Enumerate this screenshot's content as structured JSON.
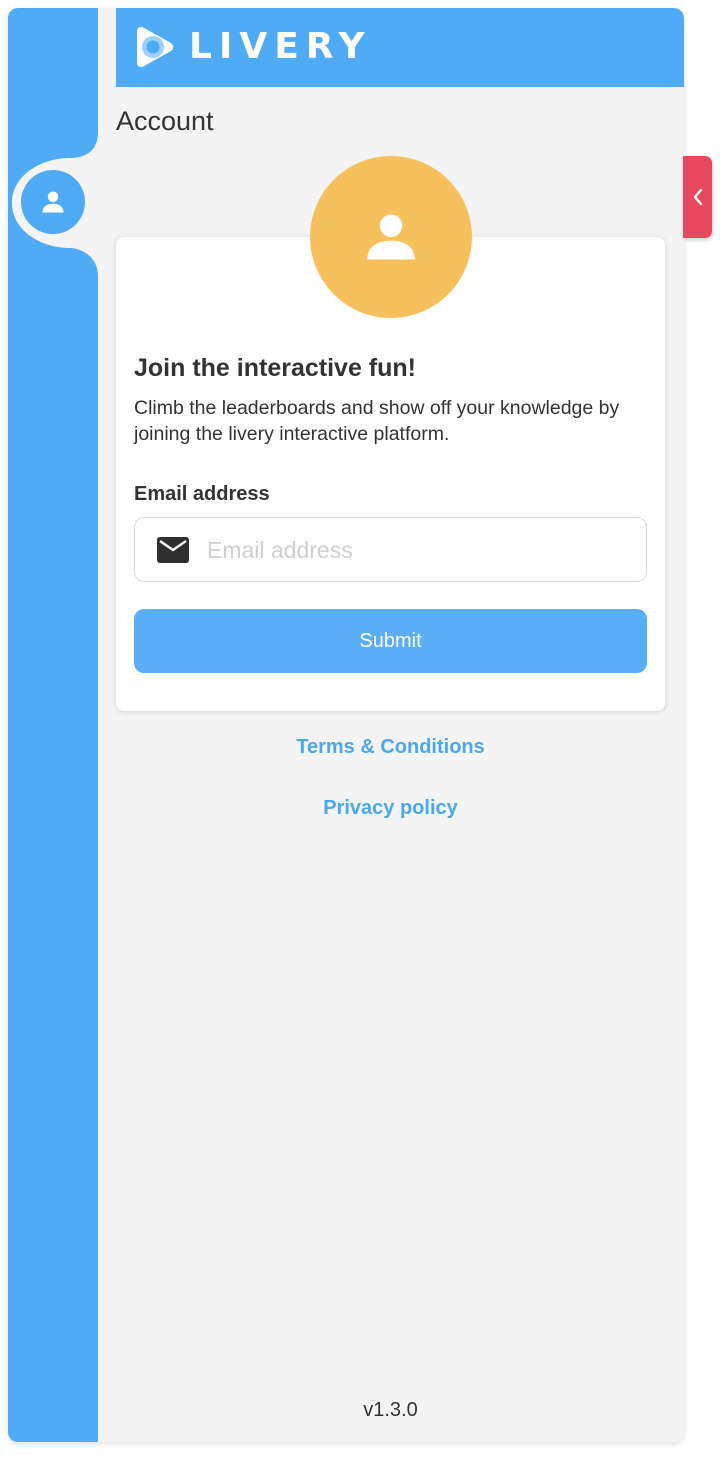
{
  "brand": {
    "name": "LIVERY",
    "color_primary": "#4fabf6",
    "color_accent": "#f6c15c",
    "color_alert": "#e8485e",
    "logo_icon": "play-logo-icon"
  },
  "header": {
    "page_title": "Account"
  },
  "sidebar": {
    "active_tab_icon": "user-icon"
  },
  "card": {
    "avatar_icon": "user-icon",
    "title": "Join the interactive fun!",
    "description": "Climb the leaderboards and show off your knowledge by joining the livery interactive platform.",
    "email": {
      "label": "Email address",
      "placeholder": "Email address",
      "value": "",
      "icon": "mail-icon"
    },
    "submit_label": "Submit"
  },
  "links": {
    "terms": "Terms & Conditions",
    "privacy": "Privacy policy"
  },
  "footer": {
    "version": "v1.3.0"
  },
  "collapse_tab": {
    "icon": "chevron-left-icon"
  }
}
